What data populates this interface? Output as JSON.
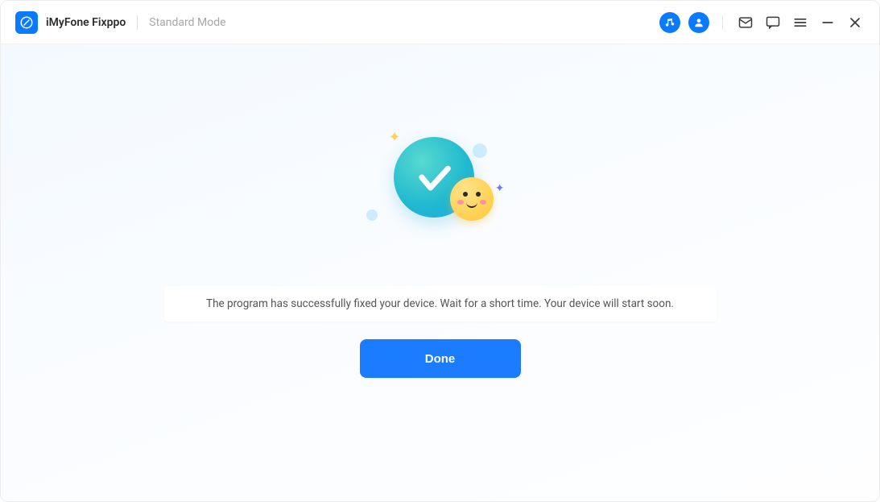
{
  "app": {
    "title": "iMyFone Fixppo",
    "mode": "Standard Mode"
  },
  "status": {
    "message": "The program has successfully fixed your device. Wait for a short time. Your device will start soon."
  },
  "actions": {
    "done_label": "Done"
  },
  "colors": {
    "primary": "#1b7cff"
  }
}
